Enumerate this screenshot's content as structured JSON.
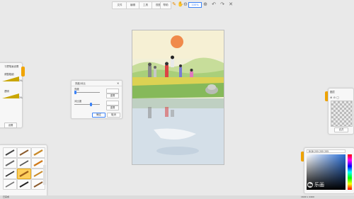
{
  "toolbar": {
    "menus": [
      "文件",
      "编辑",
      "工具",
      "视图",
      "帮助"
    ],
    "zoom": "100%",
    "icons": [
      "pen-icon",
      "hand-icon",
      "zoom-out-icon",
      "zoom-in-icon",
      "undo-icon",
      "redo-icon",
      "close-icon"
    ]
  },
  "brush_panel": {
    "title": "习惯笔画设置",
    "label_a": "调整粗细",
    "value_a": "100%",
    "label_b": "透明",
    "value_b": "100%",
    "button": "设置"
  },
  "dialog": {
    "title": "亮度/对比",
    "row1_label": "亮度",
    "row1_btn": "重置",
    "row2_label": "对比度",
    "row2_btn": "重置",
    "ok": "确定",
    "cancel": "取消"
  },
  "layers_panel": {
    "title": "图层",
    "button": "合并"
  },
  "color_panel": {
    "header": "RGB 255 255 255"
  },
  "status": {
    "left": "已完成",
    "right": "1600 x 2400"
  },
  "watermark": {
    "text": "乐画",
    "icon": "wechat-icon"
  },
  "colors": {
    "accent": "#f0a400",
    "selection": "#3b82f6"
  }
}
